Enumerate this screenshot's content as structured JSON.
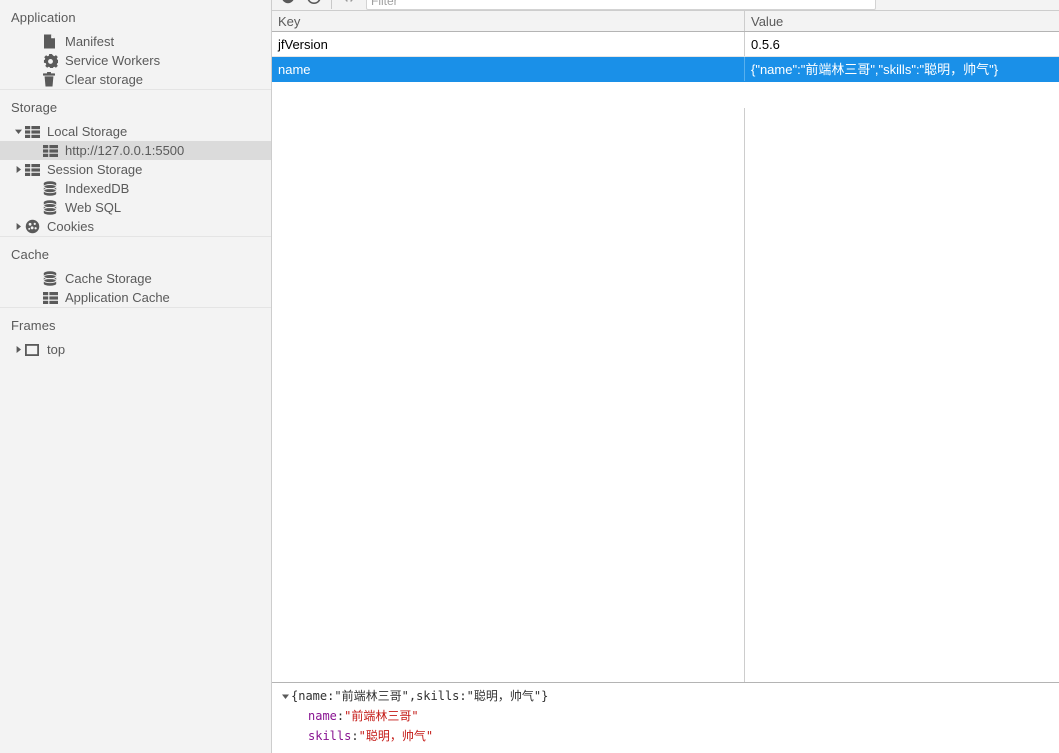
{
  "sidebar": {
    "sections": [
      {
        "title": "Application",
        "items": [
          {
            "label": "Manifest",
            "icon": "manifest-icon",
            "indent": 2,
            "twisty": "none",
            "selected": false
          },
          {
            "label": "Service Workers",
            "icon": "service-workers-icon",
            "indent": 2,
            "twisty": "none",
            "selected": false
          },
          {
            "label": "Clear storage",
            "icon": "clear-storage-icon",
            "indent": 2,
            "twisty": "none",
            "selected": false
          }
        ]
      },
      {
        "title": "Storage",
        "items": [
          {
            "label": "Local Storage",
            "icon": "table-icon",
            "indent": 1,
            "twisty": "expanded",
            "selected": false
          },
          {
            "label": "http://127.0.0.1:5500",
            "icon": "table-icon",
            "indent": 2,
            "twisty": "none",
            "selected": true
          },
          {
            "label": "Session Storage",
            "icon": "table-icon",
            "indent": 1,
            "twisty": "collapsed",
            "selected": false
          },
          {
            "label": "IndexedDB",
            "icon": "database-icon",
            "indent": 2,
            "twisty": "none",
            "selected": false
          },
          {
            "label": "Web SQL",
            "icon": "database-icon",
            "indent": 2,
            "twisty": "none",
            "selected": false
          },
          {
            "label": "Cookies",
            "icon": "cookie-icon",
            "indent": 1,
            "twisty": "collapsed",
            "selected": false
          }
        ]
      },
      {
        "title": "Cache",
        "items": [
          {
            "label": "Cache Storage",
            "icon": "database-icon",
            "indent": 2,
            "twisty": "none",
            "selected": false
          },
          {
            "label": "Application Cache",
            "icon": "table-icon",
            "indent": 2,
            "twisty": "none",
            "selected": false
          }
        ]
      },
      {
        "title": "Frames",
        "items": [
          {
            "label": "top",
            "icon": "frame-icon",
            "indent": 1,
            "twisty": "collapsed",
            "selected": false
          }
        ]
      }
    ]
  },
  "toolbar": {
    "buttons": [
      {
        "name": "clear-all-button",
        "icon": "clear-circle-icon"
      },
      {
        "name": "delete-selected-button",
        "icon": "delete-circle-icon"
      },
      {
        "name": "toggle-code-view-button",
        "icon": "code-brackets-icon"
      }
    ],
    "filter_placeholder": "Filter",
    "filter_value": ""
  },
  "table": {
    "columns": [
      {
        "key": "key",
        "label": "Key"
      },
      {
        "key": "value",
        "label": "Value"
      }
    ],
    "rows": [
      {
        "key": "jfVersion",
        "value": "0.5.6",
        "selected": false
      },
      {
        "key": "name",
        "value": "{\"name\":\"前端林三哥\",\"skills\":\"聪明，帅气\"}",
        "selected": true
      }
    ]
  },
  "preview": {
    "summary": {
      "open_brace": "{",
      "prop1": "name",
      "colon": ": ",
      "val1": "\"前端林三哥\"",
      "comma": ", ",
      "prop2": "skills",
      "val2": "\"聪明，帅气\"",
      "close_brace": "}"
    },
    "props": [
      {
        "name": "name",
        "separator": ": ",
        "value": "\"前端林三哥\""
      },
      {
        "name": "skills",
        "separator": ": ",
        "value": "\"聪明，帅气\""
      }
    ]
  },
  "colors": {
    "selection_blue": "#1a90e8",
    "sidebar_bg": "#f3f3f3",
    "tree_selected_bg": "#dbdbdb",
    "property_purple": "#881391",
    "string_red": "#c41a16"
  }
}
